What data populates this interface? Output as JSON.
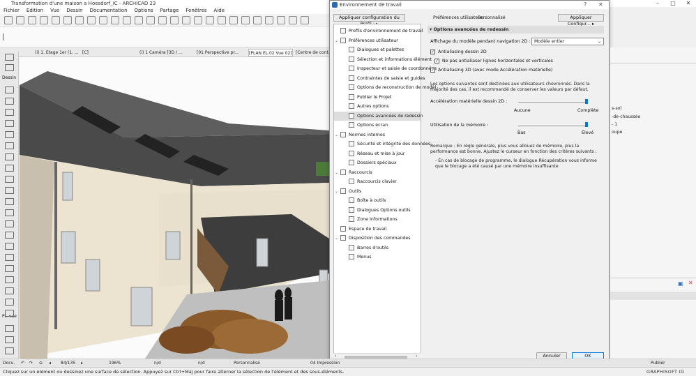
{
  "app": {
    "title": "Transformation d'une maison a Hoesdorf_IC - ARCHICAD 23",
    "brand": "GRAPHISOFT ID"
  },
  "menu": [
    "Fichier",
    "Edition",
    "Vue",
    "Dessin",
    "Documentation",
    "Options",
    "Partage",
    "Fenêtres",
    "Aide"
  ],
  "tabs": [
    "(i) 1. Etage 1er (1. ...",
    "[C]",
    "(i) 1 Caméra [3D / ...",
    "[01 Perspective pr...",
    "[PLAN EL.02 Vue 02]",
    "[Centre de cont..."
  ],
  "left_toolbox": {
    "sections": [
      "Dessin",
      "Pt. vue",
      "Docu."
    ]
  },
  "status": {
    "page": "84/135",
    "zoom": "196%",
    "nd1": "n/d",
    "nd2": "n/d",
    "nd3": "n/d",
    "profile": "Personnalisé",
    "view": "04 Impression",
    "publish": "Publier"
  },
  "hint": "Cliquez sur un élément ou dessinez une surface de sélection. Appuyez sur Ctrl+Maj pour faire alterner la sélection de l'élément et des sous-éléments.",
  "dialog": {
    "title": "Environnement de travail",
    "apply_profile_btn": "Appliquer configuration du Profil :",
    "user_prefs": "Préférences utilisateur:",
    "user_prefs_value": "Personnalisé",
    "apply_config_btn": "Appliquer Configur...",
    "tree": [
      {
        "label": "Profils d'environnement de travail",
        "level": 0
      },
      {
        "label": "Préférences utilisateur",
        "level": 0,
        "expand": true
      },
      {
        "label": "Dialogues et palettes",
        "level": 1
      },
      {
        "label": "Sélection et informations élément",
        "level": 1
      },
      {
        "label": "Inspecteur et saisie de coordonnées",
        "level": 1
      },
      {
        "label": "Contraintes de saisie et guides",
        "level": 1
      },
      {
        "label": "Options de reconstruction de modèl",
        "level": 1
      },
      {
        "label": "Publier le Projet",
        "level": 1
      },
      {
        "label": "Autres options",
        "level": 1
      },
      {
        "label": "Options avancées de redessin",
        "level": 1,
        "selected": true
      },
      {
        "label": "Options écran",
        "level": 1
      },
      {
        "label": "Normes internes",
        "level": 0,
        "expand": true
      },
      {
        "label": "Sécurité et intégrité des données",
        "level": 1
      },
      {
        "label": "Réseau et mise à jour",
        "level": 1
      },
      {
        "label": "Dossiers spéciaux",
        "level": 1
      },
      {
        "label": "Raccourcis",
        "level": 0,
        "expand": true
      },
      {
        "label": "Raccourcis clavier",
        "level": 1
      },
      {
        "label": "Outils",
        "level": 0,
        "expand": true
      },
      {
        "label": "Boîte à outils",
        "level": 1
      },
      {
        "label": "Dialogues Options outils",
        "level": 1
      },
      {
        "label": "Zone Informations",
        "level": 1
      },
      {
        "label": "Espace de travail",
        "level": 0
      },
      {
        "label": "Disposition des commandes",
        "level": 0,
        "expand": true
      },
      {
        "label": "Barres d'outils",
        "level": 1
      },
      {
        "label": "Menus",
        "level": 1
      }
    ],
    "section": "Options avancées de redessin",
    "nav2d_label": "Affichage du modèle pendant navigation 2D :",
    "nav2d_value": "Modèle entier",
    "aa2d": "Antialiasing dessin 2D",
    "no_aa_lines": "Ne pas antialiaser lignes horizontales et verticales",
    "aa3d": "Antialiasing 3D (avec mode Accélération matérielle)",
    "advanced_note": "Les options suivantes sont destinées aux utilisateurs chevronnés. Dans la majorité des cas, il est recommandé de conserver les valeurs par défaut.",
    "hw_accel": "Accélération matérielle dessin 2D :",
    "hw_min": "Aucune",
    "hw_max": "Complète",
    "memory": "Utilisation de la mémoire :",
    "mem_min": "Bas",
    "mem_max": "Élevé",
    "remark": "Remarque : En règle générale, plus vous allouez de mémoire, plus la performance est bonne. Ajustez le curseur en fonction des critères suivants :",
    "remark2": "- En cas de blocage de programme, le dialogue Récupération vous informe que le blocage a été causé par une mémoire insuffisante",
    "cancel": "Annuler",
    "ok": "OK"
  },
  "right_panel": [
    "s-sol",
    "-de-chaussée",
    "- 1",
    "oupe"
  ],
  "colors": {
    "accent": "#0078d7"
  }
}
